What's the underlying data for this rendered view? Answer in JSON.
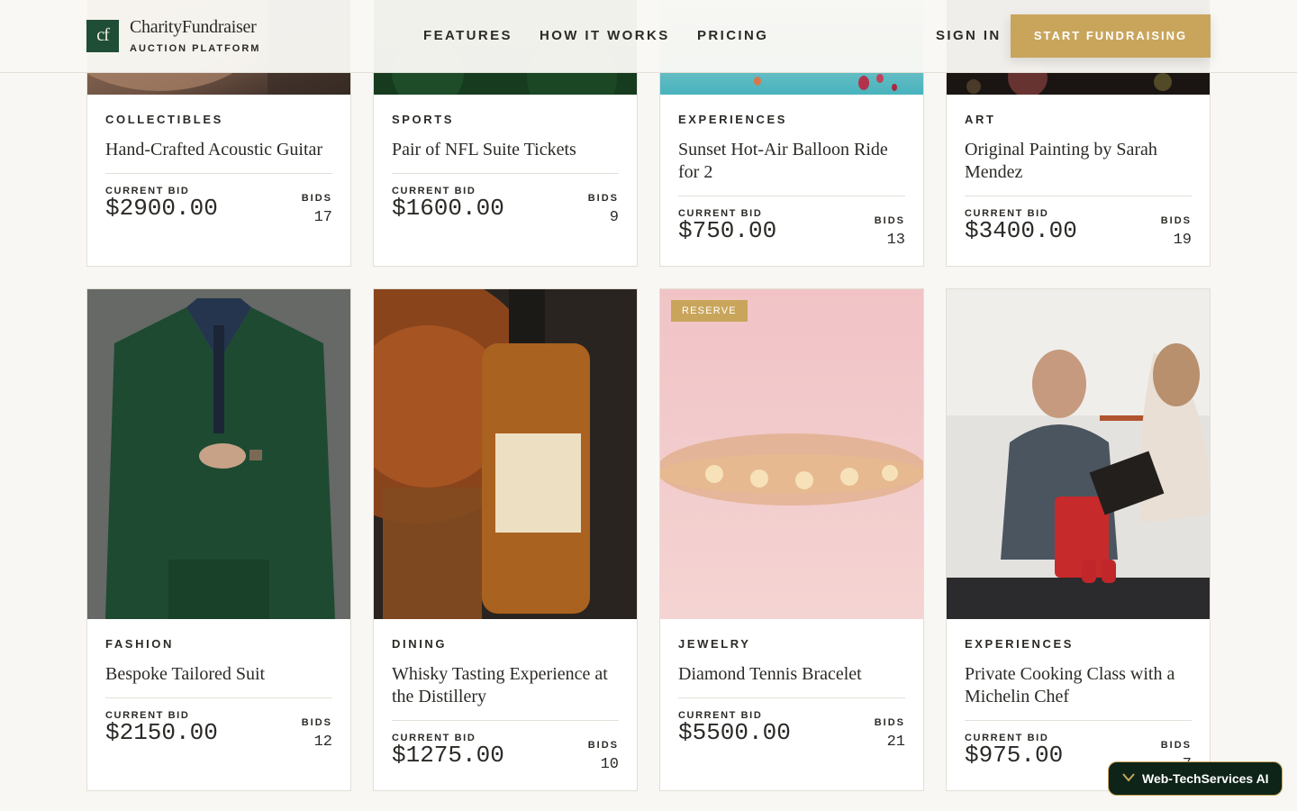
{
  "header": {
    "logo_mark": "cf",
    "brand_name": "CharityFundraiser",
    "brand_sub": "AUCTION PLATFORM",
    "nav": [
      "FEATURES",
      "HOW IT WORKS",
      "PRICING"
    ],
    "sign_in": "SIGN IN",
    "cta": "START FUNDRAISING"
  },
  "labels": {
    "current_bid": "CURRENT BID",
    "bids": "BIDS",
    "reserve": "RESERVE"
  },
  "items": [
    {
      "category": "COLLECTIBLES",
      "title": "Hand-Crafted Acoustic Guitar",
      "current_bid": "$2900.00",
      "bids": "17",
      "image": "acoustic-guitar-photo"
    },
    {
      "category": "SPORTS",
      "title": "Pair of NFL Suite Tickets",
      "current_bid": "$1600.00",
      "bids": "9",
      "image": "football-field-photo"
    },
    {
      "category": "EXPERIENCES",
      "title": "Sunset Hot-Air Balloon Ride for 2",
      "current_bid": "$750.00",
      "bids": "13",
      "image": "hot-air-balloons-photo"
    },
    {
      "category": "ART",
      "title": "Original Painting by Sarah Mendez",
      "current_bid": "$3400.00",
      "bids": "19",
      "image": "floral-painting-photo"
    },
    {
      "category": "FASHION",
      "title": "Bespoke Tailored Suit",
      "current_bid": "$2150.00",
      "bids": "12",
      "image": "green-suit-photo"
    },
    {
      "category": "DINING",
      "title": "Whisky Tasting Experience at the Distillery",
      "current_bid": "$1275.00",
      "bids": "10",
      "image": "whiskey-bottle-photo"
    },
    {
      "category": "JEWELRY",
      "title": "Diamond Tennis Bracelet",
      "current_bid": "$5500.00",
      "bids": "21",
      "image": "bracelet-photo",
      "reserve": true
    },
    {
      "category": "EXPERIENCES",
      "title": "Private Cooking Class with a Michelin Chef",
      "current_bid": "$975.00",
      "bids": "7",
      "image": "cooking-class-photo"
    }
  ],
  "badge": {
    "text": "Web-TechServices AI"
  },
  "colors": {
    "brand_green": "#1f4d36",
    "accent_gold": "#c9a55c",
    "background": "#f8f7f3"
  }
}
